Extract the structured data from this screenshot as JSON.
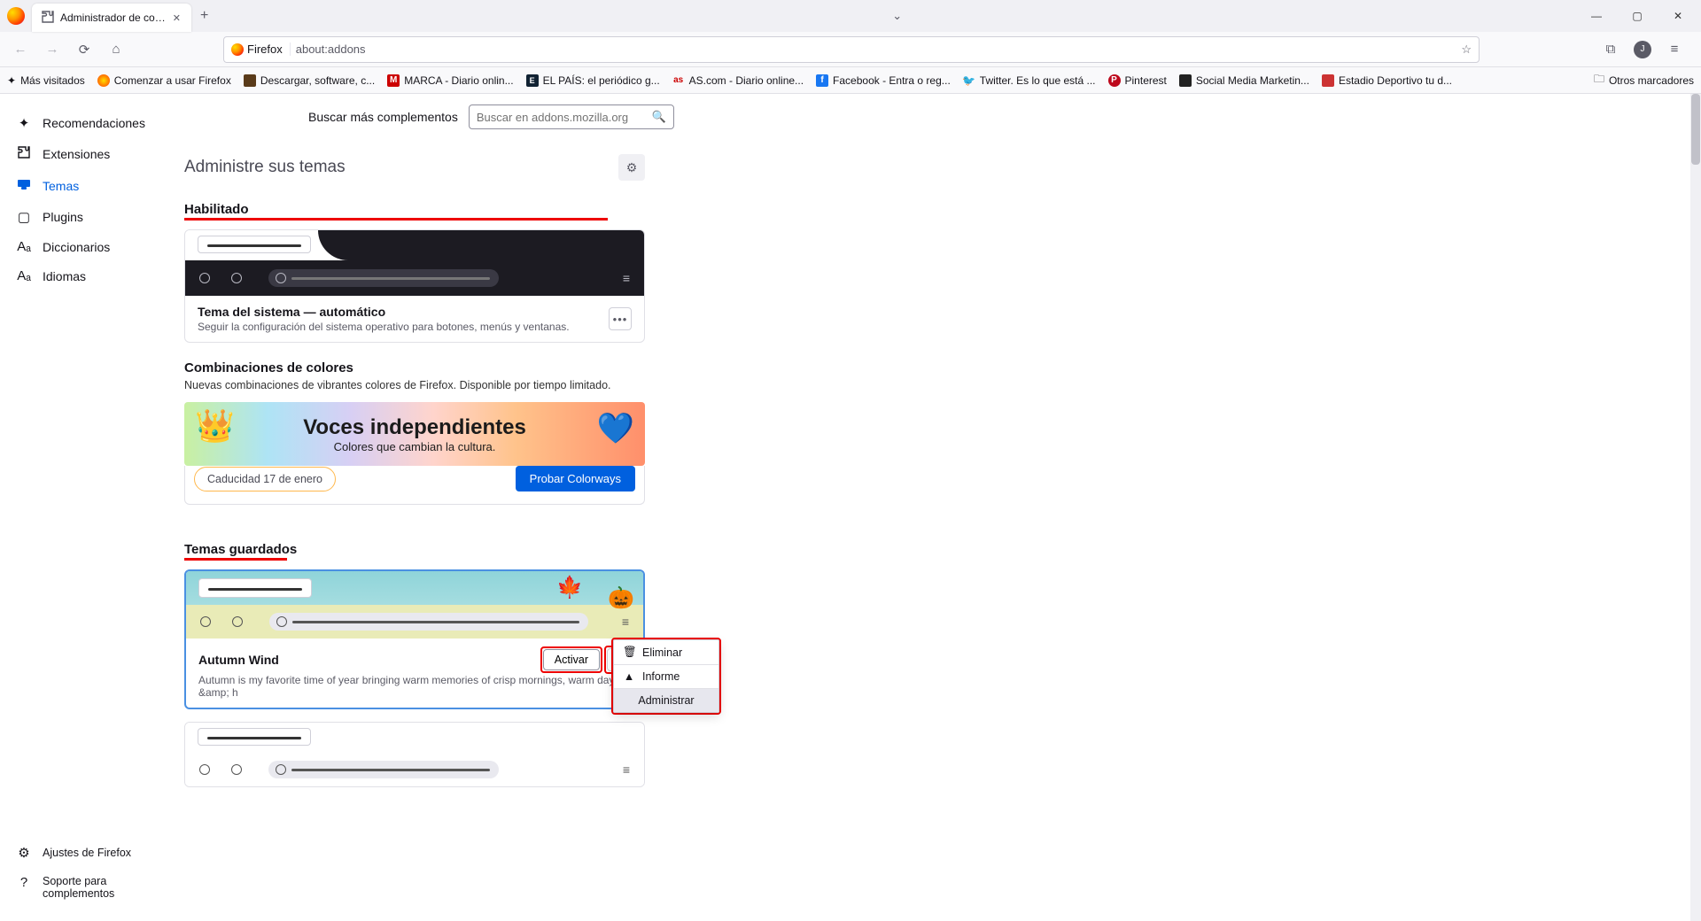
{
  "tab": {
    "title": "Administrador de complement"
  },
  "urlbar": {
    "identity": "Firefox",
    "url": "about:addons"
  },
  "bookmarks": {
    "most_visited": "Más visitados",
    "items": [
      "Comenzar a usar Firefox",
      "Descargar, software, c...",
      "MARCA - Diario onlin...",
      "EL PAÍS: el periódico g...",
      "AS.com - Diario online...",
      "Facebook - Entra o reg...",
      "Twitter. Es lo que está ...",
      "Pinterest",
      "Social Media Marketin...",
      "Estadio Deportivo tu d..."
    ],
    "other": "Otros marcadores"
  },
  "search": {
    "label": "Buscar más complementos",
    "placeholder": "Buscar en addons.mozilla.org"
  },
  "sidebar": {
    "items": [
      "Recomendaciones",
      "Extensiones",
      "Temas",
      "Plugins",
      "Diccionarios",
      "Idiomas"
    ],
    "settings": "Ajustes de Firefox",
    "support": "Soporte para complementos"
  },
  "page_title": "Administre sus temas",
  "sections": {
    "enabled": "Habilitado",
    "colorways_h": "Combinaciones de colores",
    "colorways_sub": "Nuevas combinaciones de vibrantes colores de Firefox. Disponible por tiempo limitado.",
    "saved": "Temas guardados"
  },
  "system_theme": {
    "title": "Tema del sistema — automático",
    "desc": "Seguir la configuración del sistema operativo para botones, menús y ventanas."
  },
  "banner": {
    "title": "Voces independientes",
    "subtitle": "Colores que cambian la cultura."
  },
  "colorways_ctrl": {
    "expiry": "Caducidad 17 de enero",
    "try": "Probar Colorways"
  },
  "autumn": {
    "title": "Autumn Wind",
    "desc": "Autumn is my favorite time of year bringing warm memories of crisp mornings, warm days &amp; h",
    "activate": "Activar"
  },
  "menu": {
    "delete": "Eliminar",
    "report": "Informe",
    "manage": "Administrar"
  }
}
